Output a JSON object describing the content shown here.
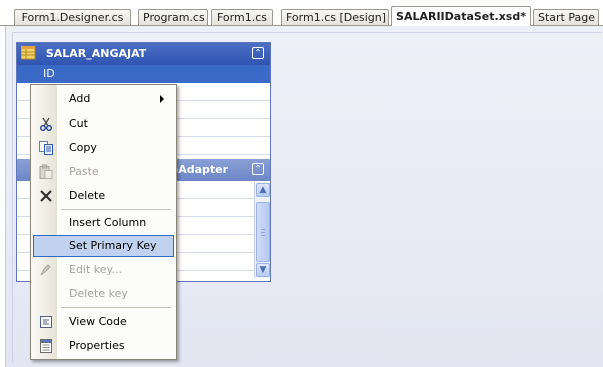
{
  "tabs": [
    {
      "label": "Form1.Designer.cs",
      "active": false
    },
    {
      "label": "Program.cs",
      "active": false
    },
    {
      "label": "Form1.cs",
      "active": false
    },
    {
      "label": "Form1.cs [Design]",
      "active": false
    },
    {
      "label": "SALARIIDataSet.xsd*",
      "active": true
    },
    {
      "label": "Start Page",
      "active": false
    }
  ],
  "table": {
    "name": "SALAR_ANGAJAT",
    "selected_row": "ID",
    "adapter_label_visible": "leAdapter"
  },
  "context_menu": {
    "items": [
      {
        "label": "Add",
        "icon": "none",
        "disabled": false,
        "submenu": true
      },
      {
        "label": "Cut",
        "icon": "scissors-icon",
        "disabled": false
      },
      {
        "label": "Copy",
        "icon": "copy-icon",
        "disabled": false
      },
      {
        "label": "Paste",
        "icon": "paste-icon",
        "disabled": true
      },
      {
        "label": "Delete",
        "icon": "delete-x-icon",
        "disabled": false
      },
      {
        "label": "Insert Column",
        "icon": "none",
        "disabled": false
      },
      {
        "label": "Set Primary Key",
        "icon": "none",
        "disabled": false,
        "highlighted": true
      },
      {
        "label": "Edit key...",
        "icon": "edit-key-icon",
        "disabled": true
      },
      {
        "label": "Delete key",
        "icon": "none",
        "disabled": true
      },
      {
        "label": "View Code",
        "icon": "view-code-icon",
        "disabled": false
      },
      {
        "label": "Properties",
        "icon": "properties-icon",
        "disabled": false
      }
    ]
  },
  "colors": {
    "table_header": "#2f55b1",
    "menu_highlight": "#c1d2ee",
    "menu_highlight_border": "#316ac5"
  }
}
